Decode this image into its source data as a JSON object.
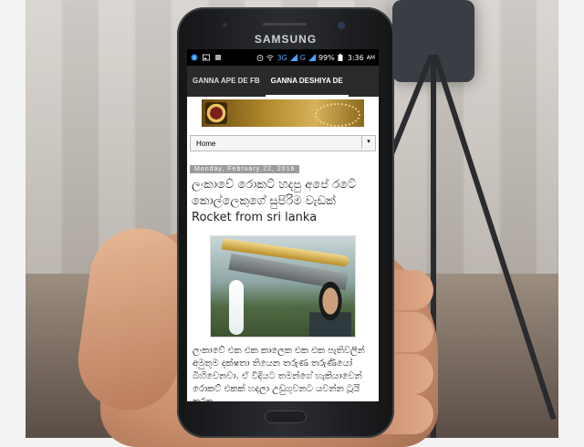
{
  "device": {
    "brand": "SAMSUNG"
  },
  "statusbar": {
    "network": "3G",
    "network2": "G",
    "battery": "99%",
    "time": "3:36",
    "ampm": "AM"
  },
  "tabs": [
    {
      "label": "GANNA APE DE FB"
    },
    {
      "label": "GANNA DESHIYA DE"
    }
  ],
  "nav": {
    "selected": "Home"
  },
  "post": {
    "date": "Monday, February 22, 2016",
    "title": "ලංකාවේ රොකට් හදපු අපේ රටේ කොල්ලෙකුගේ සුපිරිම වැඩක් Rocket from sri lanka",
    "body": "ලංකාවේ එක එක කාලෙක එක එක පැතිවලින් අමුතුම දක්ෂතා තියෙන තරුණ තරුණියෝ බිහිවෙනවා. ඒ විදියට තමන්ගේ හැකියාවෙන් රොකට් එකක් හදලා උඩුගුවනට යවන්න ටූයි කරන"
  }
}
